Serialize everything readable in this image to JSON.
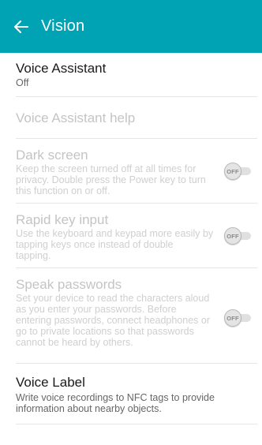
{
  "header": {
    "title": "Vision",
    "back_icon": "arrow-left-icon",
    "color": "#00a3b4"
  },
  "items": [
    {
      "title": "Voice Assistant",
      "subtitle": "Off",
      "enabled": true
    },
    {
      "title": "Voice Assistant help",
      "enabled": false
    },
    {
      "title": "Dark screen",
      "subtitle_lines": [
        "Keep the screen turned off at all times for",
        "privacy. Double press the Power key to turn",
        "this function on or off."
      ],
      "toggle": "OFF",
      "enabled": false
    },
    {
      "title": "Rapid key input",
      "subtitle_lines": [
        "Use the keyboard and keypad more easily by",
        "tapping keys once instead of double",
        "tapping."
      ],
      "toggle": "OFF",
      "enabled": false
    },
    {
      "title": "Speak passwords",
      "subtitle_lines": [
        "Set your device to read the characters aloud",
        "as you enter your passwords. Before",
        "entering passwords, connect headphones or",
        "go to private locations so that passwords",
        "cannot be heard by others."
      ],
      "toggle": "OFF",
      "enabled": false
    },
    {
      "title": "Voice Label",
      "subtitle_lines": [
        "Write voice recordings to NFC tags to provide",
        "information about nearby objects."
      ],
      "enabled": true
    }
  ]
}
